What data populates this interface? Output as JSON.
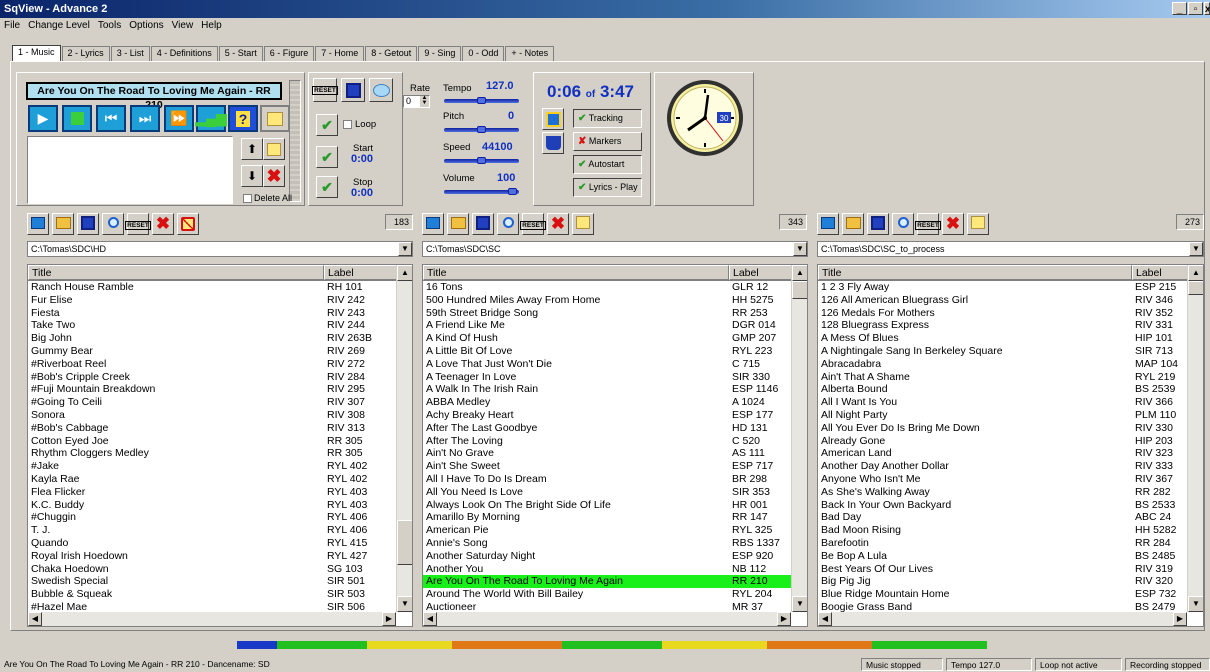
{
  "window": {
    "title": "SqView - Advance 2"
  },
  "menu": [
    "File",
    "Change Level",
    "Tools",
    "Options",
    "View",
    "Help"
  ],
  "tabs": [
    "1 - Music",
    "2 - Lyrics",
    "3 - List",
    "4 - Definitions",
    "5 - Start",
    "6 - Figure",
    "7 - Home",
    "8 - Getout",
    "9 - Sing",
    "0 - Odd",
    "+ - Notes"
  ],
  "player": {
    "song_title": "Are You On The Road To Loving Me Again - RR 210",
    "loop_label": "Loop",
    "delete_all_label": "Delete All",
    "start_label": "Start",
    "start_value": "0:00",
    "stop_label": "Stop",
    "stop_value": "0:00",
    "reset_label": "RESET"
  },
  "controls": {
    "rate_label": "Rate",
    "rate_value": "0",
    "tempo_label": "Tempo",
    "tempo_value": "127.0",
    "pitch_label": "Pitch",
    "pitch_value": "0",
    "speed_label": "Speed",
    "speed_value": "44100",
    "volume_label": "Volume",
    "volume_value": "100"
  },
  "timer": {
    "current": "0:06",
    "of": "of",
    "total": "3:47",
    "tracking": "Tracking",
    "markers": "Markers",
    "autostart": "Autostart",
    "lyrics_play": "Lyrics - Play"
  },
  "clock": {
    "label": "30"
  },
  "lists": [
    {
      "count": "183",
      "path": "C:\\Tomas\\SDC\\HD",
      "col_title": "Title",
      "col_label": "Label",
      "rows": [
        [
          "Ranch House Ramble",
          "RH 101"
        ],
        [
          "Fur Elise",
          "RIV 242"
        ],
        [
          "Fiesta",
          "RIV 243"
        ],
        [
          "Take Two",
          "RIV 244"
        ],
        [
          "Big John",
          "RIV 263B"
        ],
        [
          "Gummy Bear",
          "RIV 269"
        ],
        [
          "#Riverboat Reel",
          "RIV 272"
        ],
        [
          "#Bob's Cripple Creek",
          "RIV 284"
        ],
        [
          "#Fuji Mountain Breakdown",
          "RIV 295"
        ],
        [
          "#Going To Ceili",
          "RIV 307"
        ],
        [
          "Sonora",
          "RIV 308"
        ],
        [
          "#Bob's Cabbage",
          "RIV 313"
        ],
        [
          "Cotton Eyed Joe",
          "RR 305"
        ],
        [
          "Rhythm Cloggers Medley",
          "RR 305"
        ],
        [
          "#Jake",
          "RYL 402"
        ],
        [
          "Kayla Rae",
          "RYL 402"
        ],
        [
          "Flea Flicker",
          "RYL 403"
        ],
        [
          "K.C. Buddy",
          "RYL 403"
        ],
        [
          "#Chuggin",
          "RYL 406"
        ],
        [
          "T. J.",
          "RYL 406"
        ],
        [
          "Quando",
          "RYL 415"
        ],
        [
          "Royal Irish Hoedown",
          "RYL 427"
        ],
        [
          "Chaka Hoedown",
          "SG 103"
        ],
        [
          "Swedish Special",
          "SIR 501"
        ],
        [
          "Bubble & Squeak",
          "SIR 503"
        ],
        [
          "#Hazel Mae",
          "SIR 506"
        ]
      ]
    },
    {
      "count": "343",
      "path": "C:\\Tomas\\SDC\\SC",
      "col_title": "Title",
      "col_label": "Label",
      "rows": [
        [
          "16 Tons",
          "GLR 12"
        ],
        [
          "500 Hundred Miles Away From Home",
          "HH 5275"
        ],
        [
          "59th Street Bridge Song",
          "RR 253"
        ],
        [
          "A Friend Like Me",
          "DGR 014"
        ],
        [
          "A Kind Of Hush",
          "GMP 207"
        ],
        [
          "A Little Bit Of Love",
          "RYL 223"
        ],
        [
          "A Love That Just Won't Die",
          "C 715"
        ],
        [
          "A Teenager In Love",
          "SIR 330"
        ],
        [
          "A Walk In The Irish Rain",
          "ESP 1146"
        ],
        [
          "ABBA Medley",
          "A 1024"
        ],
        [
          "Achy Breaky Heart",
          "ESP 177"
        ],
        [
          "After The Last Goodbye",
          "HD 131"
        ],
        [
          "After The Loving",
          "C 520"
        ],
        [
          "Ain't No Grave",
          "AS 111"
        ],
        [
          "Ain't She Sweet",
          "ESP 717"
        ],
        [
          "All I Have To Do Is Dream",
          "BR 298"
        ],
        [
          "All You Need Is Love",
          "SIR 353"
        ],
        [
          "Always Look On The Bright Side Of Life",
          "HR 001"
        ],
        [
          "Amarillo By Morning",
          "RR 147"
        ],
        [
          "American Pie",
          "RYL 325"
        ],
        [
          "Annie's Song",
          "RBS 1337"
        ],
        [
          "Another Saturday Night",
          "ESP 920"
        ],
        [
          "Another You",
          "NB 112"
        ],
        [
          "Are You On The Road To Loving Me Again",
          "RR 210"
        ],
        [
          "Around The World With Bill Bailey",
          "RYL 204"
        ],
        [
          "Auctioneer",
          "MR 37"
        ]
      ]
    },
    {
      "count": "273",
      "path": "C:\\Tomas\\SDC\\SC_to_process",
      "col_title": "Title",
      "col_label": "Label",
      "rows": [
        [
          "1 2 3 Fly Away",
          "ESP 215"
        ],
        [
          "126 All American Bluegrass Girl",
          "RIV 346"
        ],
        [
          "126 Medals For Mothers",
          "RIV 352"
        ],
        [
          "128 Bluegrass Express",
          "RIV 331"
        ],
        [
          "A Mess Of Blues",
          "HIP 101"
        ],
        [
          "A Nightingale Sang In Berkeley Square",
          "SIR 713"
        ],
        [
          "Abracadabra",
          "MAP 104"
        ],
        [
          "Ain't That A Shame",
          "RYL 219"
        ],
        [
          "Alberta Bound",
          "BS 2539"
        ],
        [
          "All I Want Is You",
          "RIV 366"
        ],
        [
          "All Night Party",
          "PLM 110"
        ],
        [
          "All You Ever Do Is Bring Me Down",
          "RIV 330"
        ],
        [
          "Already Gone",
          "HIP 203"
        ],
        [
          "American Land",
          "RIV 323"
        ],
        [
          "Another Day Another Dollar",
          "RIV 333"
        ],
        [
          "Anyone Who Isn't Me",
          "RIV 367"
        ],
        [
          "As She's Walking Away",
          "RR 282"
        ],
        [
          "Back In Your Own Backyard",
          "BS 2533"
        ],
        [
          "Bad Day",
          "ABC 24"
        ],
        [
          "Bad Moon Rising",
          "HH 5282"
        ],
        [
          "Barefootin",
          "RR 284"
        ],
        [
          "Be Bop A Lula",
          "BS 2485"
        ],
        [
          "Best Years Of Our Lives",
          "RIV 319"
        ],
        [
          "Big Pig Jig",
          "RIV 320"
        ],
        [
          "Blue Ridge Mountain Home",
          "ESP 732"
        ],
        [
          "Boogie Grass Band",
          "BS 2479"
        ]
      ]
    }
  ],
  "status": {
    "left": "Are You On The Road To Loving Me Again - RR 210 - Dancename: SD",
    "music": "Music stopped",
    "tempo": "Tempo 127.0",
    "loop": "Loop not active",
    "recording": "Recording stopped"
  }
}
